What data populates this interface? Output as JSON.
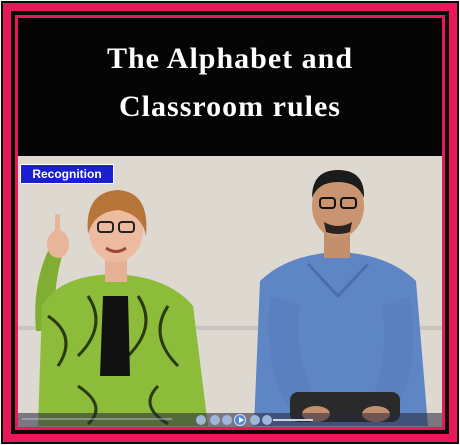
{
  "title": {
    "line1": "The Alphabet and",
    "line2": "Classroom rules"
  },
  "video": {
    "badge_label": "Recognition"
  },
  "colors": {
    "frame": "#e8185a",
    "border": "#0a0a0a",
    "badge": "#1a1fd0",
    "woman_jacket": "#8dbb3a",
    "man_shirt": "#5f86c4"
  },
  "player": {
    "icons": [
      "stop-icon",
      "previous-icon",
      "play-icon",
      "next-icon",
      "volume-icon"
    ]
  }
}
